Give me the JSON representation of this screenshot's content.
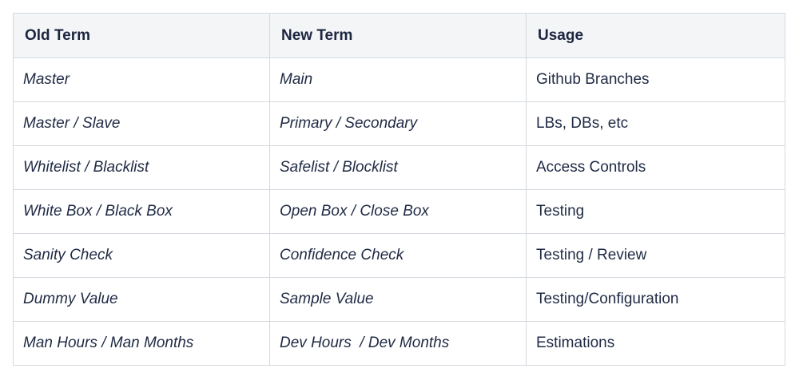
{
  "table": {
    "headers": [
      "Old Term",
      "New Term",
      "Usage"
    ],
    "rows": [
      [
        "Master",
        "Main",
        "Github Branches"
      ],
      [
        "Master / Slave",
        "Primary / Secondary",
        "LBs, DBs, etc"
      ],
      [
        "Whitelist / Blacklist",
        "Safelist / Blocklist",
        "Access Controls"
      ],
      [
        "White Box / Black Box",
        "Open Box / Close Box",
        "Testing"
      ],
      [
        "Sanity Check",
        "Confidence Check",
        "Testing / Review"
      ],
      [
        "Dummy Value",
        "Sample Value",
        "Testing/Configuration"
      ],
      [
        "Man Hours / Man Months",
        "Dev Hours  / Dev Months",
        "Estimations"
      ]
    ]
  },
  "colors": {
    "header_background": "#f4f5f7",
    "border": "#d3d8df",
    "text": "#1f2a44"
  }
}
